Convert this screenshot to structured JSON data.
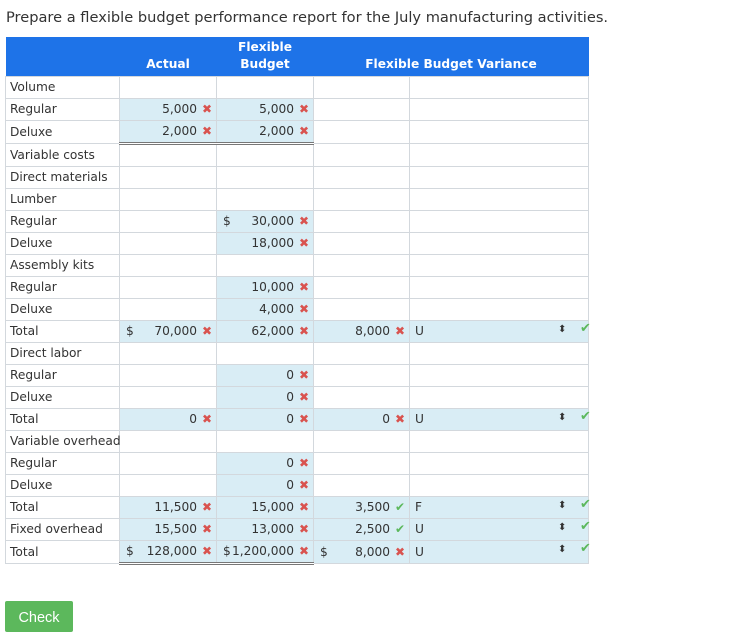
{
  "prompt": "Prepare a flexible budget performance report for the July manufacturing activities.",
  "header": {
    "actual": "Actual",
    "flex_line1": "Flexible",
    "flex_line2": "Budget",
    "variance": "Flexible Budget Variance"
  },
  "rows": [
    {
      "label": "Volume"
    },
    {
      "label": "Regular",
      "actual": {
        "cur": "",
        "val": "5,000",
        "mark": "x"
      },
      "flex": {
        "cur": "",
        "val": "5,000",
        "mark": "x"
      }
    },
    {
      "label": "Deluxe",
      "actual": {
        "cur": "",
        "val": "2,000",
        "mark": "x"
      },
      "flex": {
        "cur": "",
        "val": "2,000",
        "mark": "x"
      }
    },
    {
      "label": "Variable costs"
    },
    {
      "label": "Direct materials"
    },
    {
      "label": "Lumber"
    },
    {
      "label": "Regular",
      "flex": {
        "cur": "$",
        "val": "30,000",
        "mark": "x"
      }
    },
    {
      "label": "Deluxe",
      "flex": {
        "cur": "",
        "val": "18,000",
        "mark": "x"
      }
    },
    {
      "label": "Assembly kits"
    },
    {
      "label": "Regular",
      "flex": {
        "cur": "",
        "val": "10,000",
        "mark": "x"
      }
    },
    {
      "label": "Deluxe",
      "flex": {
        "cur": "",
        "val": "4,000",
        "mark": "x"
      }
    },
    {
      "label": "Total",
      "actual": {
        "cur": "$",
        "val": "70,000",
        "mark": "x"
      },
      "flex": {
        "cur": "",
        "val": "62,000",
        "mark": "x"
      },
      "var": {
        "val": "8,000",
        "mark": "x",
        "fu": "U"
      }
    },
    {
      "label": "Direct labor"
    },
    {
      "label": "Regular",
      "flex": {
        "cur": "",
        "val": "0",
        "mark": "x"
      }
    },
    {
      "label": "Deluxe",
      "flex": {
        "cur": "",
        "val": "0",
        "mark": "x"
      }
    },
    {
      "label": "Total",
      "actual": {
        "cur": "",
        "val": "0",
        "mark": "x"
      },
      "flex": {
        "cur": "",
        "val": "0",
        "mark": "x"
      },
      "var": {
        "val": "0",
        "mark": "x",
        "fu": "U"
      }
    },
    {
      "label": "Variable overhead"
    },
    {
      "label": "Regular",
      "flex": {
        "cur": "",
        "val": "0",
        "mark": "x"
      }
    },
    {
      "label": "Deluxe",
      "flex": {
        "cur": "",
        "val": "0",
        "mark": "x"
      }
    },
    {
      "label": "Total",
      "actual": {
        "cur": "",
        "val": "11,500",
        "mark": "x"
      },
      "flex": {
        "cur": "",
        "val": "15,000",
        "mark": "x"
      },
      "var": {
        "val": "3,500",
        "mark": "ok",
        "fu": "F"
      }
    },
    {
      "label": "Fixed overhead",
      "actual": {
        "cur": "",
        "val": "15,500",
        "mark": "x"
      },
      "flex": {
        "cur": "",
        "val": "13,000",
        "mark": "x"
      },
      "var": {
        "val": "2,500",
        "mark": "ok",
        "fu": "U"
      }
    },
    {
      "label": "Total",
      "actual": {
        "cur": "$",
        "val": "128,000",
        "mark": "x"
      },
      "flex": {
        "cur": "$",
        "val": "1,200,000",
        "mark": "x"
      },
      "var": {
        "cur": "$",
        "val": "8,000",
        "mark": "x",
        "fu": "U"
      }
    }
  ],
  "icons": {
    "x": "✖",
    "ok": "✔",
    "select": "⬍",
    "check": "✔"
  },
  "colors": {
    "header_bg": "#1e73e8",
    "input_bg": "#d9edf5",
    "wrong": "#d9534f",
    "correct": "#5cb85c"
  },
  "check_button": "Check"
}
